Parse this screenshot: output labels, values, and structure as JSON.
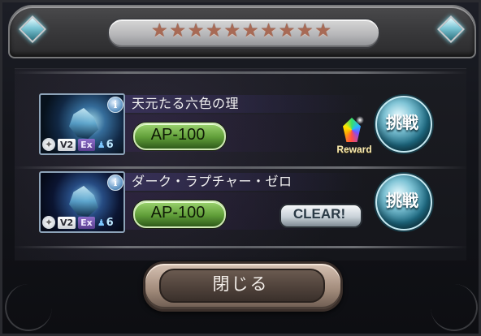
{
  "dialog": {
    "stars": [
      "★",
      "★",
      "★",
      "★",
      "★",
      "★",
      "★",
      "★",
      "★",
      "★"
    ],
    "quests": [
      {
        "title": "天元たる六色の理",
        "ap": "AP-100",
        "badges": {
          "lock": "✦",
          "version": "V2",
          "mode": "Ex",
          "count": "6"
        },
        "reward_label": "Reward",
        "challenge_label": "挑戦",
        "info_label": "i"
      },
      {
        "title": "ダーク・ラプチャー・ゼロ",
        "ap": "AP-100",
        "badges": {
          "lock": "✦",
          "version": "V2",
          "mode": "Ex",
          "count": "6"
        },
        "clear_label": "CLEAR!",
        "challenge_label": "挑戦",
        "info_label": "i"
      }
    ],
    "close_label": "閉じる"
  },
  "colors": {
    "ap_green": "#6fb347",
    "challenge_blue": "#2a7f98",
    "star_copper": "#a86a55",
    "close_brown": "#8f7767"
  }
}
